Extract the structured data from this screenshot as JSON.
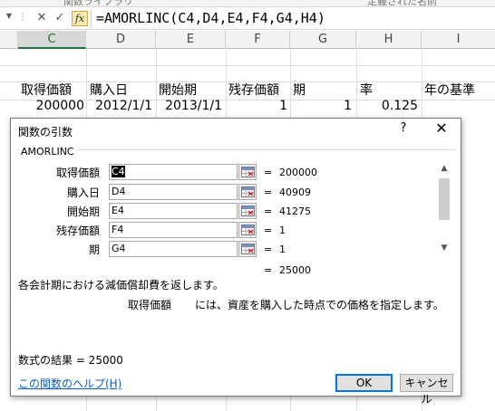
{
  "window": {
    "top_strip_left": "関数ライブラリ",
    "top_strip_right": "定義された名前"
  },
  "formula_bar": {
    "cancel_glyph": "✕",
    "enter_glyph": "✓",
    "fx_label": "fx",
    "formula": "=AMORLINC(C4,D4,E4,F4,G4,H4)"
  },
  "columns": [
    "C",
    "D",
    "E",
    "F",
    "G",
    "H",
    "I"
  ],
  "selected_column": "C",
  "sheet": {
    "headers": [
      "取得価額",
      "購入日",
      "開始期",
      "残存価額",
      "期",
      "率",
      "年の基準"
    ],
    "row": [
      "200000",
      "2012/1/1",
      "2013/1/1",
      "1",
      "1",
      "0.125",
      ""
    ]
  },
  "dialog": {
    "title": "関数の引数",
    "help_glyph": "?",
    "close_glyph": "✕",
    "function_name": "AMORLINC",
    "args": [
      {
        "label": "取得価額",
        "input": "C4",
        "value": "200000"
      },
      {
        "label": "購入日",
        "input": "D4",
        "value": "40909"
      },
      {
        "label": "開始期",
        "input": "E4",
        "value": "41275"
      },
      {
        "label": "残存価額",
        "input": "F4",
        "value": "1"
      },
      {
        "label": "期",
        "input": "G4",
        "value": "1"
      }
    ],
    "equals": "=",
    "result_value": "25000",
    "description": "各会計期における減価償却費を返します。",
    "arg_desc_name": "取得価額",
    "arg_desc_text": "には、資産を購入した時点での価格を指定します。",
    "formula_result": "数式の結果 =  25000",
    "help_link": "この関数のヘルプ(H)",
    "ok_label": "OK",
    "cancel_label": "キャンセル"
  }
}
